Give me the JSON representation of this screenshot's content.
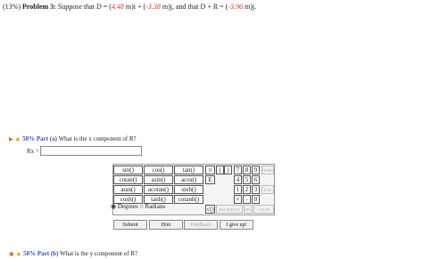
{
  "problem": {
    "prefix": "(13%)",
    "title": "Problem 3:",
    "text_a": "Suppose that D = (",
    "dx": "4.48",
    "text_b": " m)i + (",
    "dy": "-3.38",
    "text_c": " m)j, and that D + R = (",
    "sy": "-3.96",
    "text_d": " m)j."
  },
  "part_a": {
    "pct": "50% Part (a)",
    "question": "What is the x component of R?",
    "label": "Rx =",
    "value": ""
  },
  "keypad": {
    "functions": [
      [
        "sin()",
        "cos()",
        "tan()"
      ],
      [
        "cotan()",
        "asin()",
        "acos()"
      ],
      [
        "atan()",
        "acotan()",
        "sinh()"
      ],
      [
        "cosh()",
        "tanh()",
        "cotanh()"
      ]
    ],
    "consts": [
      "π",
      "E"
    ],
    "parens": [
      "(",
      ")"
    ],
    "digits": [
      [
        "7",
        "8",
        "9"
      ],
      [
        "4",
        "5",
        "6"
      ],
      [
        "1",
        "2",
        "3"
      ],
      [
        "+",
        "-",
        "0"
      ]
    ],
    "side_top": "HOME",
    "side_mid": "",
    "side_end": "END",
    "backspace": "←",
    "sqrt": "√()",
    "backspace_label": "BACKSPACE",
    "del_label": "DEL",
    "clear_label": "CLEAR",
    "degrees": "Degrees",
    "radians": "Radians"
  },
  "buttons": {
    "submit": "Submit",
    "hint": "Hint",
    "feedback": "Feedback",
    "give_up": "I give up!"
  },
  "part_b": {
    "pct": "50% Part (b)",
    "question": "What is the y component of R?"
  }
}
